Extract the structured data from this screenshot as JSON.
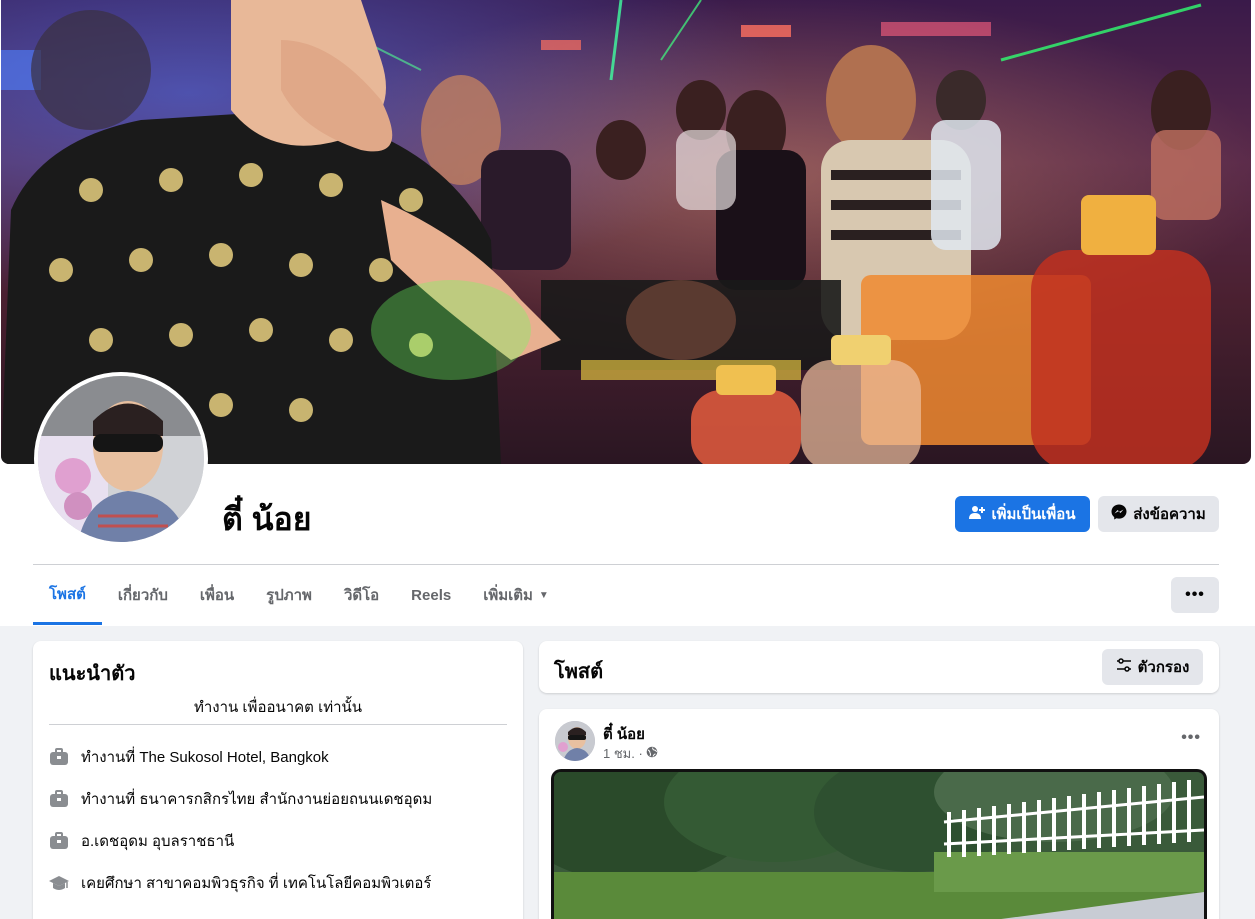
{
  "profile": {
    "name": "ตี๋ น้อย",
    "add_friend_label": "เพิ่มเป็นเพื่อน",
    "message_label": "ส่งข้อความ"
  },
  "tabs": [
    {
      "label": "โพสต์",
      "active": true
    },
    {
      "label": "เกี่ยวกับ"
    },
    {
      "label": "เพื่อน"
    },
    {
      "label": "รูปภาพ"
    },
    {
      "label": "วิดีโอ"
    },
    {
      "label": "Reels"
    },
    {
      "label": "เพิ่มเติม",
      "caret": "▼"
    }
  ],
  "more_label": "•••",
  "intro": {
    "title": "แนะนำตัว",
    "bio": "ทำงาน เพื่ออนาคต เท่านั้น",
    "items": [
      {
        "icon": "briefcase-icon",
        "text": "ทำงานที่ The Sukosol Hotel, Bangkok"
      },
      {
        "icon": "briefcase-icon",
        "text": "ทำงานที่ ธนาคารกสิกรไทย สำนักงานย่อยถนนเดชอุดม"
      },
      {
        "icon": "briefcase-icon",
        "text": "อ.เดชอุดม อุบลราชธานี"
      },
      {
        "icon": "graduation-cap-icon",
        "text": "เคยศึกษา สาขาคอมพิวธุรกิจ ที่ เทคโนโลยีคอมพิวเตอร์"
      }
    ]
  },
  "posts": {
    "title": "โพสต์",
    "filter_label": "ตัวกรอง"
  },
  "post": {
    "author": "ตี๋ น้อย",
    "time": "1 ชม. ·",
    "privacy_icon": "globe-icon",
    "more_label": "•••"
  },
  "colors": {
    "accent": "#1b74e4",
    "secondary_button": "#e4e6eb",
    "page_bg": "#f0f2f5",
    "muted_text": "#65676b"
  }
}
